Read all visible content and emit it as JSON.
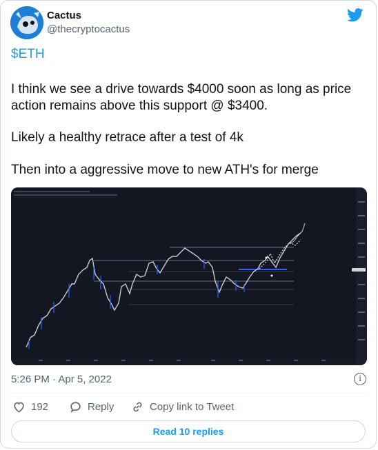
{
  "author": {
    "name": "Cactus",
    "handle": "@thecryptocactus"
  },
  "tweet": {
    "cashtag": "$ETH",
    "paragraph1": "I think we see a drive towards $4000 soon as long as price",
    "paragraph1b": "action remains above this support @ $3400.",
    "paragraph2": "Likely a healthy retrace after a test of 4k",
    "paragraph3": "Then into a aggressive move to new ATH's for merge"
  },
  "timestamp": "5:26 PM · Apr 5, 2022",
  "actions": {
    "likes": "192",
    "reply_label": "Reply",
    "copy_label": "Copy link to Tweet"
  },
  "read_replies_label": "Read 10 replies",
  "icons": {
    "logo": "twitter-bird-icon",
    "info": "info-icon",
    "like": "heart-icon",
    "reply": "reply-bubble-icon",
    "copy": "link-icon"
  },
  "colors": {
    "accent": "#1d9bf0",
    "chart_bg": "#131722",
    "muted": "#536471"
  }
}
